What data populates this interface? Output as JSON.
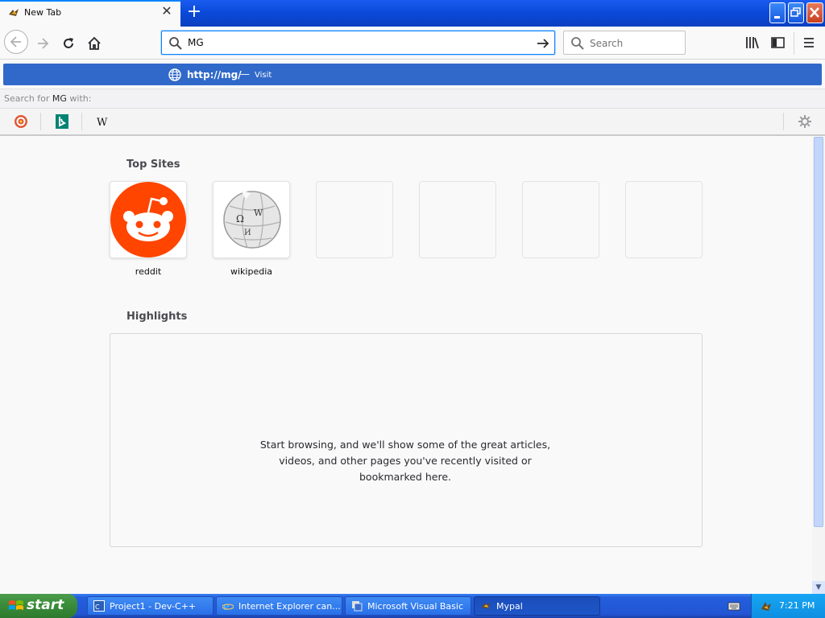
{
  "tab": {
    "title": "New Tab"
  },
  "urlbar": {
    "value": "MG"
  },
  "searchbar": {
    "placeholder": "Search"
  },
  "popup": {
    "url": "http://mg/",
    "dash": "—",
    "action": "Visit",
    "search_for_prefix": "Search for ",
    "search_for_term": "MG",
    "search_for_suffix": " with:",
    "engines": [
      "duckduckgo-icon",
      "bing-icon",
      "wikipedia-icon"
    ]
  },
  "content": {
    "top_sites_title": "Top Sites",
    "top_sites": [
      {
        "label": "reddit",
        "icon": "reddit-icon"
      },
      {
        "label": "wikipedia",
        "icon": "wikipedia-globe-icon"
      },
      {
        "label": ""
      },
      {
        "label": ""
      },
      {
        "label": ""
      },
      {
        "label": ""
      }
    ],
    "highlights_title": "Highlights",
    "highlights_empty": "Start browsing, and we'll show some of the great articles, videos, and other pages you've recently visited or bookmarked here."
  },
  "taskbar": {
    "start": "start",
    "tasks": [
      {
        "label": "Project1 - Dev-C++",
        "icon": "devcpp-icon"
      },
      {
        "label": "Internet Explorer can...",
        "icon": "ie-icon"
      },
      {
        "label": "Microsoft Visual Basic",
        "icon": "vb-icon"
      },
      {
        "label": "Mypal",
        "icon": "mypal-icon",
        "active": true
      }
    ],
    "clock": "7:21 PM"
  },
  "colors": {
    "accent": "#0a84ff",
    "popup_selected": "#3069c9",
    "reddit": "#ff4500",
    "taskbar": "#245edc",
    "start": "#3b8e3b"
  }
}
